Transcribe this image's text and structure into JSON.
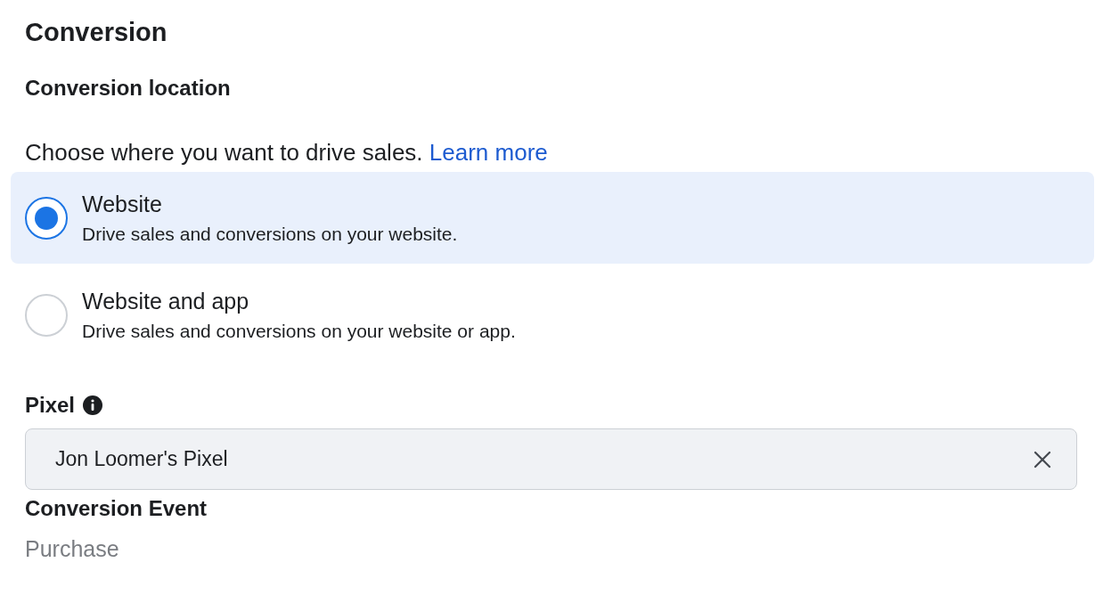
{
  "section_title": "Conversion",
  "location": {
    "heading": "Conversion location",
    "prompt": "Choose where you want to drive sales.",
    "link": "Learn more",
    "options": [
      {
        "title": "Website",
        "description": "Drive sales and conversions on your website.",
        "selected": true
      },
      {
        "title": "Website and app",
        "description": "Drive sales and conversions on your website or app.",
        "selected": false
      }
    ]
  },
  "pixel": {
    "label": "Pixel",
    "value": "Jon Loomer's Pixel"
  },
  "conversion_event": {
    "label": "Conversion Event",
    "value": "Purchase"
  }
}
